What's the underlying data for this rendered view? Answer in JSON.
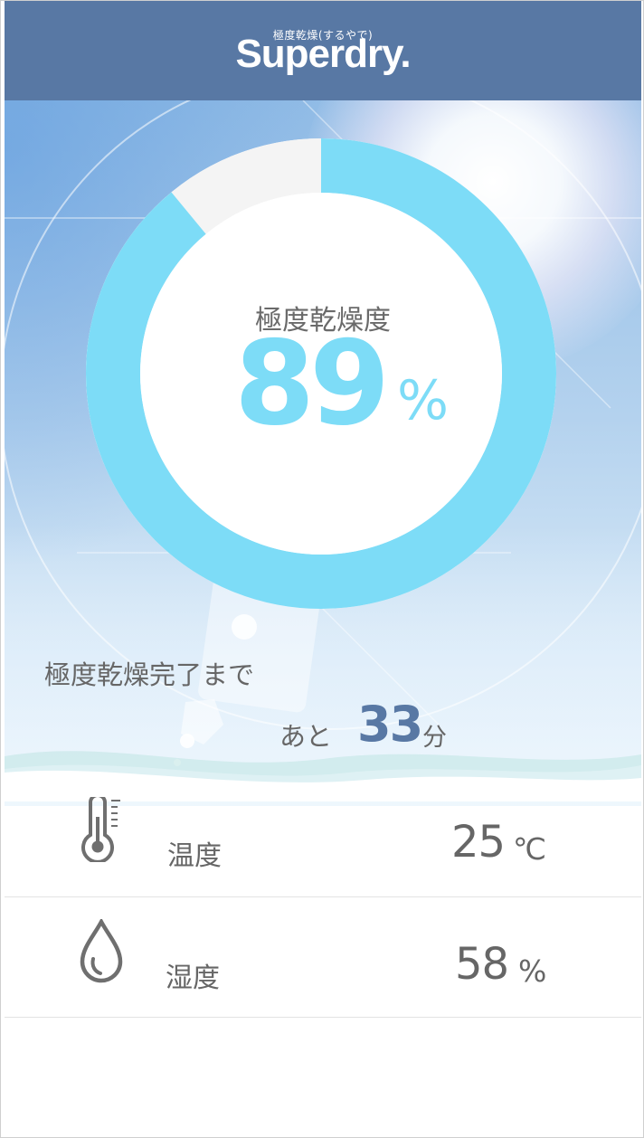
{
  "header": {
    "logo_subtitle": "極度乾燥(するやで)",
    "logo_text": "Superdry."
  },
  "gauge": {
    "label": "極度乾燥度",
    "value": "89",
    "unit": "%",
    "fraction": 0.89,
    "fill_color": "#7ddcf7",
    "track_color": "#f4f4f4"
  },
  "remaining": {
    "label": "極度乾燥完了まで",
    "prefix": "あと",
    "value": "33",
    "unit": "分",
    "value_color": "#5878a4"
  },
  "readings": [
    {
      "icon": "thermometer-icon",
      "label": "温度",
      "value": "25",
      "unit": "℃"
    },
    {
      "icon": "water-drop-icon",
      "label": "湿度",
      "value": "58",
      "unit": "%"
    }
  ],
  "colors": {
    "header_bg": "#5878a4",
    "text_gray": "#666666"
  }
}
